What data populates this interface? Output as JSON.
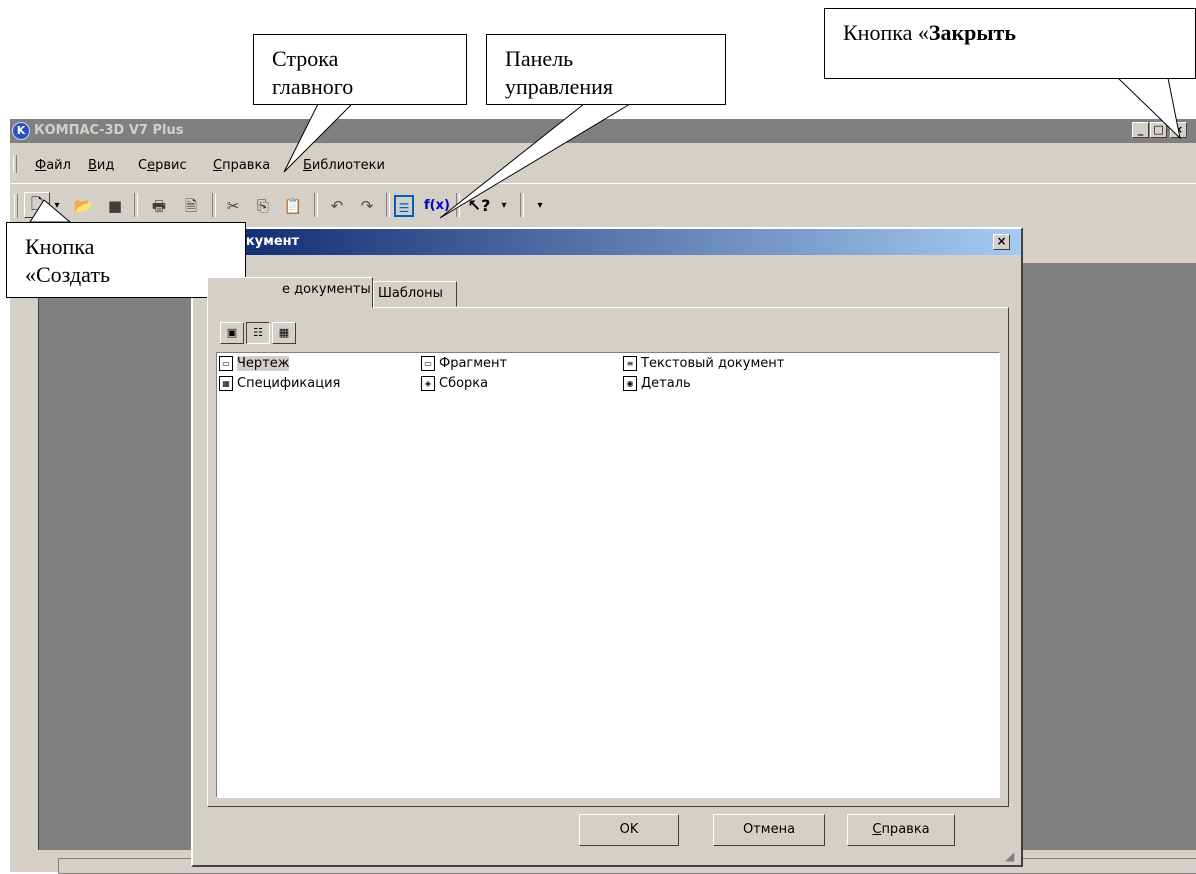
{
  "app": {
    "title": "КОМПАС-3D V7 Plus",
    "icon": "kompas-logo-icon",
    "window_buttons": [
      "minimize-icon",
      "maximize-icon",
      "close-icon"
    ]
  },
  "menu": {
    "items": [
      "Файл",
      "Вид",
      "Сервис",
      "Справка",
      "Библиотеки"
    ],
    "underlined_first_letter": [
      "Ф",
      "В",
      "е",
      "С",
      "Б"
    ]
  },
  "toolbar": {
    "icons": [
      "new-document-icon",
      "dropdown-arrow-icon",
      "open-folder-icon",
      "save-icon",
      "print-icon",
      "print-preview-icon",
      "cut-icon",
      "copy-icon",
      "paste-icon",
      "undo-icon",
      "redo-icon",
      "calculator-icon",
      "function-icon",
      "context-help-icon",
      "more-options-icon"
    ],
    "function_label": "f(x)"
  },
  "dialog": {
    "title": "окумент",
    "tabs": [
      "е документы",
      "Шаблоны"
    ],
    "view_buttons": [
      "large-icons-view-icon",
      "list-view-icon",
      "details-view-icon"
    ],
    "documents": [
      {
        "label": "Чертеж",
        "icon": "drawing-doc-icon",
        "selected": true
      },
      {
        "label": "Фрагмент",
        "icon": "fragment-doc-icon",
        "selected": false
      },
      {
        "label": "Текстовый документ",
        "icon": "text-doc-icon",
        "selected": false
      },
      {
        "label": "Спецификация",
        "icon": "specification-doc-icon",
        "selected": false
      },
      {
        "label": "Сборка",
        "icon": "assembly-doc-icon",
        "selected": false
      },
      {
        "label": "Деталь",
        "icon": "part-doc-icon",
        "selected": false
      }
    ],
    "buttons": {
      "ok": "OK",
      "cancel": "Отмена",
      "help": "Справка"
    }
  },
  "callouts": {
    "menu_line": "Строка",
    "menu_line_cut": "главного",
    "control_panel": "Панель",
    "control_panel_cut": "управления",
    "close_prefix": "Кнопка «",
    "close_bold": "Закрыть",
    "create": "Кнопка",
    "create_cut": "«Создать"
  },
  "colors": {
    "window_face": "#d4d0c8",
    "mdi_background": "#808080",
    "title_gradient_start": "#0a246a",
    "title_gradient_end": "#a6caf0"
  }
}
